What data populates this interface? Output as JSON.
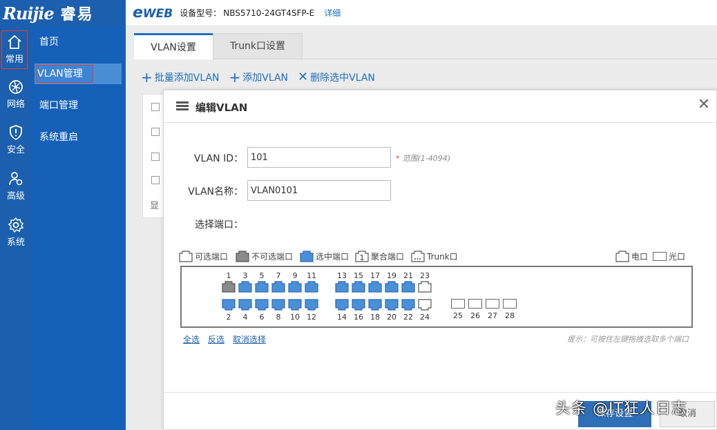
{
  "brand": {
    "logo_text": "Ruijie",
    "logo_cn": "睿易",
    "product": "WEB",
    "product_prefix": "e"
  },
  "header": {
    "model_label": "设备型号：",
    "model_value": "NBS5710-24GT4SFP-E",
    "detail_link": "详细"
  },
  "rail": [
    {
      "label": "常用",
      "icon": "home-icon",
      "active": true
    },
    {
      "label": "网络",
      "icon": "network-icon"
    },
    {
      "label": "安全",
      "icon": "shield-icon"
    },
    {
      "label": "高级",
      "icon": "advanced-user-icon"
    },
    {
      "label": "系统",
      "icon": "gear-icon"
    }
  ],
  "submenu": [
    {
      "label": "首页"
    },
    {
      "label": "VLAN管理",
      "active": true
    },
    {
      "label": "端口管理"
    },
    {
      "label": "系统重启"
    }
  ],
  "tabs": [
    {
      "label": "VLAN设置",
      "active": true
    },
    {
      "label": "Trunk口设置"
    }
  ],
  "toolbar": {
    "batch_add": "批量添加VLAN",
    "add": "添加VLAN",
    "delete_selected": "删除选中VLAN"
  },
  "background": {
    "show_label": "显"
  },
  "modal": {
    "title": "编辑VLAN",
    "vlan_id_label": "VLAN ID：",
    "vlan_id_value": "101",
    "vlan_id_hint": "范围(1-4094)",
    "vlan_name_label": "VLAN名称：",
    "vlan_name_value": "VLAN0101",
    "select_ports_label": "选择端口："
  },
  "legend": {
    "selectable": "可选端口",
    "unselectable": "不可选端口",
    "selected": "选中端口",
    "aggregate": "聚合端口",
    "aggregate_digit": "1",
    "trunk": "Trunk口",
    "copper": "电口",
    "fiber": "光口"
  },
  "ports": {
    "top": [
      {
        "num": "1",
        "state": "unselectable"
      },
      {
        "num": "3",
        "state": "selected"
      },
      {
        "num": "5",
        "state": "selected"
      },
      {
        "num": "7",
        "state": "selected"
      },
      {
        "num": "9",
        "state": "selected"
      },
      {
        "num": "11",
        "state": "selected"
      },
      {
        "num": "13",
        "state": "selected"
      },
      {
        "num": "15",
        "state": "selected"
      },
      {
        "num": "17",
        "state": "selected"
      },
      {
        "num": "19",
        "state": "selected"
      },
      {
        "num": "21",
        "state": "selected"
      },
      {
        "num": "23",
        "state": "selectable"
      }
    ],
    "bottom": [
      {
        "num": "2",
        "state": "selected"
      },
      {
        "num": "4",
        "state": "selected"
      },
      {
        "num": "6",
        "state": "selected"
      },
      {
        "num": "8",
        "state": "selected"
      },
      {
        "num": "10",
        "state": "selected"
      },
      {
        "num": "12",
        "state": "selected"
      },
      {
        "num": "14",
        "state": "selected"
      },
      {
        "num": "16",
        "state": "selected"
      },
      {
        "num": "18",
        "state": "selected"
      },
      {
        "num": "20",
        "state": "selected"
      },
      {
        "num": "22",
        "state": "selected"
      },
      {
        "num": "24",
        "state": "selectable"
      }
    ],
    "fiber": [
      {
        "num": "25"
      },
      {
        "num": "26"
      },
      {
        "num": "27"
      },
      {
        "num": "28"
      }
    ]
  },
  "links": {
    "select_all": "全选",
    "invert": "反选",
    "clear": "取消选择"
  },
  "hint": "提示：可按住左键拖拽选取多个端口",
  "buttons": {
    "save": "保存设置",
    "cancel": "取消"
  },
  "watermark": "头条 @IT狂人日志",
  "colors": {
    "brand_blue": "#1b5fae",
    "port_selected": "#4a90d9",
    "port_unselectable": "#8a8a8a",
    "required": "#e23c3c"
  }
}
